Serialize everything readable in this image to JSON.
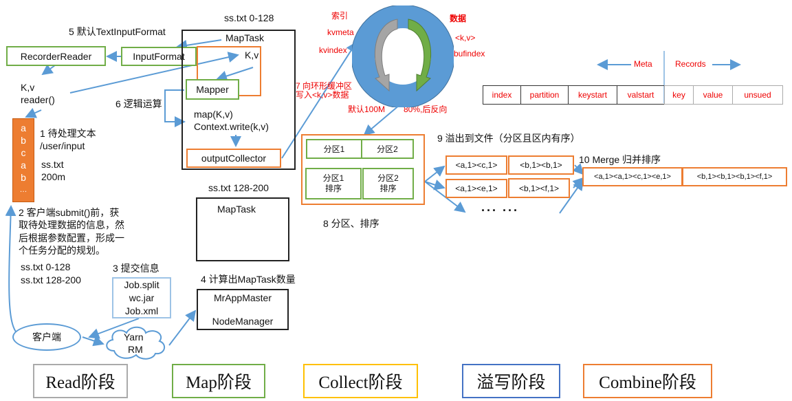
{
  "labels": {
    "step5": "5 默认TextInputFormat",
    "recorder_reader": "RecorderReader",
    "input_format": "InputFormat",
    "kv_reader_1": "K,v",
    "kv_reader_2": "reader()",
    "step6": "6 逻辑运算",
    "split1_title": "ss.txt 0-128",
    "maptask1": "MapTask",
    "kv_inner": "K,v",
    "mapper": "Mapper",
    "map_call_1": "map(K,v)",
    "map_call_2": "Context.write(k,v)",
    "output_collector": "outputCollector",
    "split2_title": "ss.txt 128-200",
    "maptask2": "MapTask",
    "step1_1": "1 待处理文本",
    "step1_2": "/user/input",
    "file_name": "ss.txt",
    "file_size": "200m",
    "file_chars": [
      "a",
      "b",
      "c",
      "a",
      "b",
      "…"
    ],
    "step2_lines": [
      "2 客户端submit()前，获",
      "取待处理数据的信息，然",
      "后根据参数配置，形成一",
      "个任务分配的规划。"
    ],
    "split_list": [
      "ss.txt  0-128",
      "ss.txt  128-200"
    ],
    "step3": "3 提交信息",
    "job_files": [
      "Job.split",
      "wc.jar",
      "Job.xml"
    ],
    "step4": "4 计算出MapTask数量",
    "mr_app_master": "MrAppMaster",
    "node_manager": "NodeManager",
    "client": "客户端",
    "yarn_1": "Yarn",
    "yarn_2": "RM"
  },
  "ring_buffer": {
    "index_title": "索引",
    "kvmeta": "kvmeta",
    "kvindex": "kvindex",
    "data_title": "数据",
    "kv": "<k,v>",
    "bufindex": "bufindex",
    "step7_1": "7 向环形缓冲区",
    "step7_2": "写入<k,v>数据",
    "default_size": "默认100M",
    "reverse": "80%,后反向",
    "ring_color": "#5b9bd5",
    "meta_arrow_color": "#999999",
    "data_arrow_color": "#5b8f2e"
  },
  "buffer_layout": {
    "meta_label": "Meta",
    "records_label": "Records",
    "meta_cells": [
      "index",
      "partition",
      "keystart",
      "valstart"
    ],
    "record_cells": [
      "key",
      "value",
      "unsued"
    ]
  },
  "partition": {
    "p1": "分区1",
    "p2": "分区2",
    "p1_sort_1": "分区1",
    "p1_sort_2": "排序",
    "p2_sort_1": "分区2",
    "p2_sort_2": "排序",
    "step8": "8 分区、排序"
  },
  "spill": {
    "step9": "9 溢出到文件（分区且区内有序）",
    "file1": [
      "<a,1><c,1>",
      "<b,1><b,1>"
    ],
    "file2": [
      "<a,1><e,1>",
      "<b,1><f,1>"
    ],
    "ellipsis": "··· ···"
  },
  "merge": {
    "step10": "10 Merge 归并排序",
    "result": [
      "<a,1><a,1><c,1><e,1>",
      "<b,1><b,1><b,1><f,1>"
    ]
  },
  "legend": [
    {
      "label": "Read阶段",
      "color": "#aaaaaa"
    },
    {
      "label": "Map阶段",
      "color": "#70ad47"
    },
    {
      "label": "Collect阶段",
      "color": "#ffc000"
    },
    {
      "label": "溢写阶段",
      "color": "#4472c4"
    },
    {
      "label": "Combine阶段",
      "color": "#ed7d31"
    }
  ],
  "colors": {
    "arrow": "#5b9bd5",
    "read_file": "#ed7d31",
    "annotation_red": "#ee0000"
  }
}
